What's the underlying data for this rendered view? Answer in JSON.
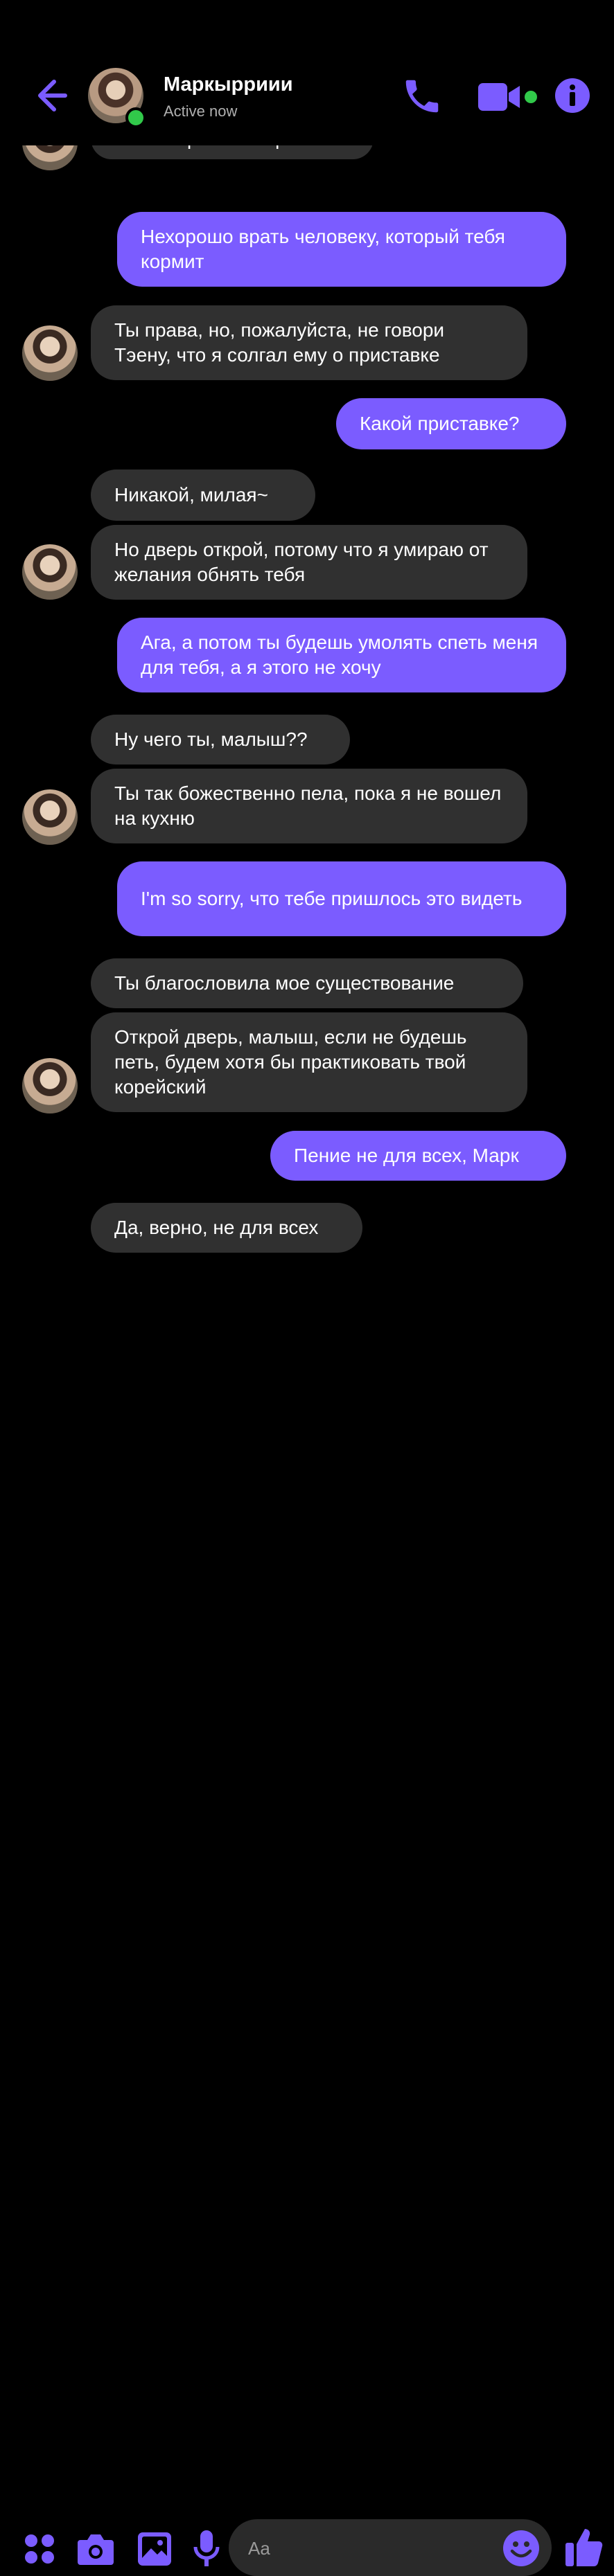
{
  "header": {
    "name": "Маркырриии",
    "status": "Active now"
  },
  "messages": [
    {
      "dir": "in",
      "text": "Ты невероятно хороша"
    },
    {
      "dir": "out",
      "text": "Нехорошо врать человеку, который тебя кормит"
    },
    {
      "dir": "in",
      "text": "Ты права, но, пожалуйста, не говори Тэену, что я солгал ему о приставке"
    },
    {
      "dir": "out",
      "text": "Какой приставке?"
    },
    {
      "dir": "in",
      "text": "Никакой, милая~"
    },
    {
      "dir": "in",
      "text": "Но дверь открой, потому что я умираю от желания обнять тебя"
    },
    {
      "dir": "out",
      "text": "Ага, а потом ты будешь умолять спеть меня для тебя, а я этого не хочу"
    },
    {
      "dir": "in",
      "text": "Ну чего ты, малыш??"
    },
    {
      "dir": "in",
      "text": "Ты так божественно пела, пока я не вошел на кухню"
    },
    {
      "dir": "out",
      "text": "I'm so sorry, что тебе пришлось это видеть"
    },
    {
      "dir": "in",
      "text": "Ты благословила мое существование"
    },
    {
      "dir": "in",
      "text": "Открой дверь, малыш, если не будешь петь, будем хотя бы практиковать твой корейский"
    },
    {
      "dir": "out",
      "text": "Пение не для всех, Марк"
    },
    {
      "dir": "in",
      "text": "Да, верно, не для всех"
    }
  ],
  "composer": {
    "placeholder": "Aa",
    "icons": [
      "apps-icon",
      "camera-icon",
      "gallery-icon",
      "microphone-icon",
      "emoji-icon",
      "like-icon"
    ]
  },
  "colors": {
    "accent": "#7b5cff",
    "incoming_bubble": "#303030",
    "background": "#000000",
    "online": "#31c94a"
  }
}
